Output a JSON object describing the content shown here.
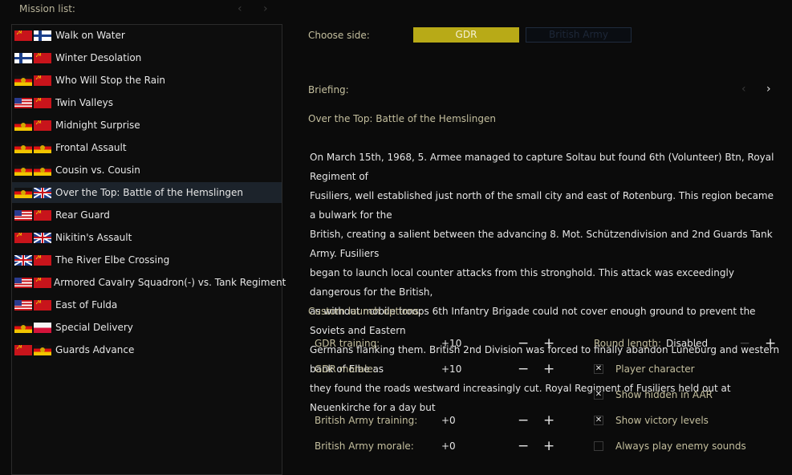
{
  "mission_list": {
    "header": "Mission list:",
    "prev_icon": "‹",
    "next_icon": "›",
    "selected_index": 7,
    "items": [
      {
        "label": "Walk on Water",
        "flags": [
          "ussr",
          "finland"
        ]
      },
      {
        "label": "Winter Desolation",
        "flags": [
          "finland",
          "ussr"
        ]
      },
      {
        "label": "Who Will Stop the Rain",
        "flags": [
          "gdr",
          "ussr"
        ]
      },
      {
        "label": "Twin Valleys",
        "flags": [
          "usa",
          "ussr"
        ]
      },
      {
        "label": "Midnight Surprise",
        "flags": [
          "gdr",
          "ussr"
        ]
      },
      {
        "label": "Frontal Assault",
        "flags": [
          "gdr",
          "gdr"
        ]
      },
      {
        "label": "Cousin vs. Cousin",
        "flags": [
          "gdr",
          "gdr"
        ]
      },
      {
        "label": "Over the Top: Battle of the Hemslingen",
        "flags": [
          "gdr",
          "uk"
        ]
      },
      {
        "label": "Rear Guard",
        "flags": [
          "usa",
          "ussr"
        ]
      },
      {
        "label": "Nikitin's Assault",
        "flags": [
          "ussr",
          "uk"
        ]
      },
      {
        "label": "The River Elbe Crossing",
        "flags": [
          "uk",
          "ussr"
        ]
      },
      {
        "label": "Armored Cavalry Squadron(-) vs. Tank Regiment",
        "flags": [
          "usa",
          "ussr"
        ]
      },
      {
        "label": "East of Fulda",
        "flags": [
          "usa",
          "ussr"
        ]
      },
      {
        "label": "Special Delivery",
        "flags": [
          "gdr",
          "poland"
        ]
      },
      {
        "label": "Guards Advance",
        "flags": [
          "ussr",
          "gdr"
        ]
      }
    ]
  },
  "side": {
    "label": "Choose side:",
    "options": [
      "GDR",
      "British Army"
    ],
    "selected": "GDR"
  },
  "briefing": {
    "label": "Briefing:",
    "prev_icon": "‹",
    "next_icon": "›",
    "title": "Over the Top: Battle of the Hemslingen",
    "lines": [
      "On March 15th, 1968, 5. Armee managed to capture Soltau but found 6th (Volunteer) Btn, Royal Regiment of",
      "Fusiliers, well established just north of the small city and east of Rotenburg. This region became a bulwark for the",
      "British, creating a salient between the advancing 8. Mot. Schützendivision and 2nd Guards Tank Army. Fusiliers",
      "began to launch local counter attacks from this stronghold. This attack was exceedingly dangerous for the British,",
      "as without mobile troops 6th Infantry Brigade could not cover enough ground to prevent the Soviets and Eastern",
      "Germans flanking them. British 2nd Division was forced to finally abandon Lüneburg and western bank of Elbe as",
      "they found the roads westward increasingly cut. Royal Regiment of Fusiliers held out at Neuenkirche for a day but"
    ]
  },
  "launch_options": {
    "label": "Custom launch options:",
    "minus_icon": "−",
    "plus_icon": "+",
    "check_icon": "✕",
    "steppers": [
      {
        "label": "GDR training:",
        "value": "+10"
      },
      {
        "label": "GDR morale:",
        "value": "+10"
      },
      {
        "label": "British Army training:",
        "value": "+0"
      },
      {
        "label": "British Army morale:",
        "value": "+0"
      }
    ],
    "round_length": {
      "label": "Round length:",
      "value": "Disabled"
    },
    "checkboxes": [
      {
        "label": "Player character",
        "checked": true
      },
      {
        "label": "Show hidden in AAR",
        "checked": true
      },
      {
        "label": "Show victory levels",
        "checked": true
      },
      {
        "label": "Always play enemy sounds",
        "checked": false
      }
    ]
  }
}
